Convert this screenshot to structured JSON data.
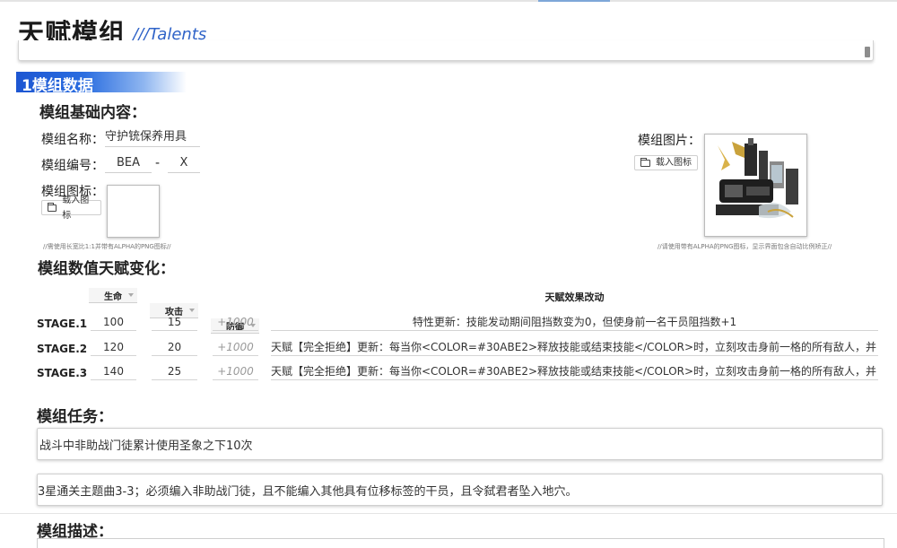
{
  "header": {
    "title_cn": "天赋模组",
    "title_en": "///Talents"
  },
  "section": {
    "title": "1模组数据"
  },
  "basic": {
    "heading": "模组基础内容：",
    "name_label": "模组名称：",
    "name_value": "守护铳保养用具",
    "code_label": "模组编号：",
    "code_prefix": "BEA",
    "code_dash": "-",
    "code_suffix": "X",
    "icon_label": "模组图标：",
    "icon_button": "载入图标",
    "icon_note": "//需使用长宽比1:1并带有ALPHA的PNG图标//",
    "image_label": "模组图片：",
    "image_button": "载入图标",
    "image_note": "//请使用带有ALPHA的PNG图标，显示界面包含自动比例矫正//"
  },
  "stats": {
    "heading": "模组数值天赋变化：",
    "columns": [
      "生命",
      "攻击",
      "防御"
    ],
    "effect_header": "天赋效果改动",
    "rows": [
      {
        "stage": "STAGE.1",
        "hp": "100",
        "atk": "15",
        "def": "+1000",
        "effect": "特性更新：技能发动期间阻挡数变为0，但使身前一名干员阻挡数+1"
      },
      {
        "stage": "STAGE.2",
        "hp": "120",
        "atk": "20",
        "def": "+1000",
        "effect": "天赋【完全拒绝】更新：每当你<COLOR=#30ABE2>释放技能或结束技能</COLOR>时，立刻攻击身前一格的所有敌人，并"
      },
      {
        "stage": "STAGE.3",
        "hp": "140",
        "atk": "25",
        "def": "+1000",
        "effect": "天赋【完全拒绝】更新：每当你<COLOR=#30ABE2>释放技能或结束技能</COLOR>时，立刻攻击身前一格的所有敌人，并"
      }
    ]
  },
  "missions": {
    "heading": "模组任务：",
    "items": [
      "战斗中非助战门徒累计使用圣象之下10次",
      "3星通关主题曲3-3；必须编入非助战门徒，且不能编入其他具有位移标签的干员，且令弑君者坠入地穴。"
    ]
  },
  "description": {
    "heading": "模组描述："
  },
  "colors": {
    "accent": "#1d56d2",
    "title_en": "#2f63c8"
  },
  "icons": {
    "load_icon": "folder-icon",
    "dropdown_icon": "chevron-down-icon"
  }
}
